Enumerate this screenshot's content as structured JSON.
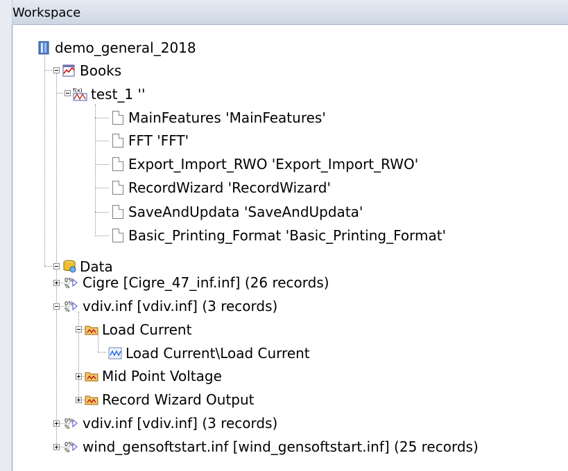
{
  "workspace": {
    "title": "Workspace",
    "root": "demo_general_2018",
    "books": {
      "label": "Books",
      "book": {
        "label": "test_1 ''",
        "pages": [
          "MainFeatures 'MainFeatures'",
          "FFT 'FFT'",
          "Export_Import_RWO 'Export_Import_RWO'",
          "RecordWizard 'RecordWizard'",
          "SaveAndUpdata 'SaveAndUpdata'",
          "Basic_Printing_Format 'Basic_Printing_Format'"
        ]
      }
    },
    "data": {
      "label": "Data",
      "files": [
        "Cigre [Cigre_47_inf.inf] (26 records)",
        "vdiv.inf [vdiv.inf] (3 records)",
        "vdiv.inf [vdiv.inf] (3 records)",
        "wind_gensoftstart.inf [wind_gensoftstart.inf] (25 records)"
      ],
      "records": [
        "Load Current",
        "Mid Point Voltage",
        "Record Wizard Output"
      ],
      "load_current_item": "Load Current\\Load Current"
    }
  }
}
